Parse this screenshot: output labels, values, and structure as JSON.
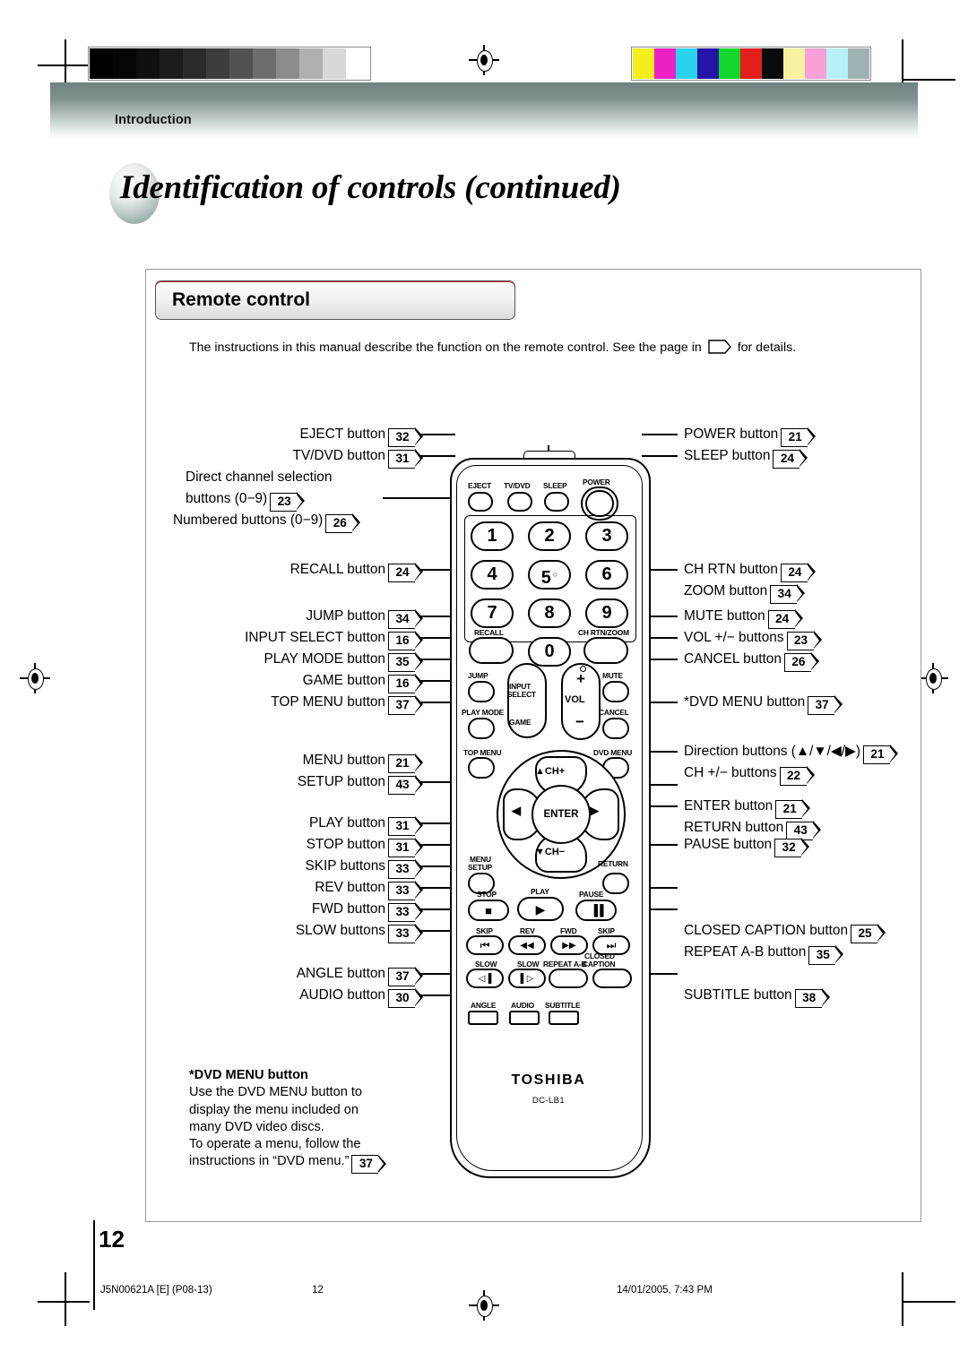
{
  "header": {
    "section": "Introduction",
    "title": "Identification of controls (continued)"
  },
  "panel": {
    "tab_label": "Remote control",
    "lead_before": "The instructions in this manual describe the function on the remote control. See the page in",
    "lead_after": "for details."
  },
  "left_labels": [
    {
      "text": "EJECT button",
      "page": "32"
    },
    {
      "text": "TV/DVD button",
      "page": "31"
    },
    {
      "text": "Direct channel selection",
      "page": ""
    },
    {
      "text": "buttons (0−9)",
      "page": "23"
    },
    {
      "text": "Numbered buttons (0−9)",
      "page": "26"
    },
    {
      "text": "RECALL button",
      "page": "24"
    },
    {
      "text": "JUMP button",
      "page": "34"
    },
    {
      "text": "INPUT SELECT button",
      "page": "16"
    },
    {
      "text": "PLAY MODE button",
      "page": "35"
    },
    {
      "text": "GAME button",
      "page": "16"
    },
    {
      "text": "TOP MENU button",
      "page": "37"
    },
    {
      "text": "MENU button",
      "page": "21"
    },
    {
      "text": "SETUP button",
      "page": "43"
    },
    {
      "text": "PLAY button",
      "page": "31"
    },
    {
      "text": "STOP button",
      "page": "31"
    },
    {
      "text": "SKIP buttons",
      "page": "33"
    },
    {
      "text": "REV button",
      "page": "33"
    },
    {
      "text": "FWD button",
      "page": "33"
    },
    {
      "text": "SLOW buttons",
      "page": "33"
    },
    {
      "text": "ANGLE button",
      "page": "37"
    },
    {
      "text": "AUDIO button",
      "page": "30"
    }
  ],
  "right_labels": [
    {
      "text": "POWER button",
      "page": "21"
    },
    {
      "text": "SLEEP button",
      "page": "24"
    },
    {
      "text": "CH RTN button",
      "page": "24"
    },
    {
      "text": "ZOOM button",
      "page": "34"
    },
    {
      "text": "MUTE button",
      "page": "24"
    },
    {
      "text": "VOL +/− buttons",
      "page": "23"
    },
    {
      "text": "CANCEL button",
      "page": "26"
    },
    {
      "text": "*DVD MENU button",
      "page": "37"
    },
    {
      "text": "Direction buttons (▲/▼/◀/▶)",
      "page": "21"
    },
    {
      "text": "CH +/− buttons",
      "page": "22"
    },
    {
      "text": "ENTER button",
      "page": "21"
    },
    {
      "text": "RETURN button",
      "page": "43"
    },
    {
      "text": "PAUSE button",
      "page": "32"
    },
    {
      "text": "CLOSED CAPTION button",
      "page": "25"
    },
    {
      "text": "REPEAT A-B button",
      "page": "35"
    },
    {
      "text": "SUBTITLE button",
      "page": "38"
    }
  ],
  "remote": {
    "caps": {
      "eject": "EJECT",
      "tvdvd": "TV/DVD",
      "sleep": "SLEEP",
      "power": "POWER",
      "recall": "RECALL",
      "chrtnzoom": "CH RTN/ZOOM",
      "jump": "JUMP",
      "mute": "MUTE",
      "input": "INPUT",
      "select": "SELECT",
      "game": "GAME",
      "playmode": "PLAY MODE",
      "cancel": "CANCEL",
      "topmenu": "TOP MENU",
      "dvdmenu": "DVD MENU",
      "menu": "MENU",
      "setup": "SETUP",
      "return": "RETURN",
      "stop": "STOP",
      "play": "PLAY",
      "pause": "PAUSE",
      "skip_l": "SKIP",
      "rev": "REV",
      "fwd": "FWD",
      "skip_r": "SKIP",
      "slow_l": "SLOW",
      "slow_r": "SLOW",
      "repeat": "REPEAT A-B",
      "closed": "CLOSED",
      "caption": "CAPTION",
      "angle": "ANGLE",
      "audio": "AUDIO",
      "subtitle": "SUBTITLE",
      "vol": "VOL",
      "chplus": "▲CH+",
      "chminus": "▼CH−",
      "enter": "ENTER"
    },
    "keypad": [
      "1",
      "2",
      "3",
      "4",
      "5",
      "6",
      "7",
      "8",
      "9",
      "0"
    ],
    "key5_mark": "○",
    "glyphs": {
      "stop": "■",
      "play": "▶",
      "pause": "▐▐",
      "skip_l": "⏮",
      "rev": "◀◀",
      "fwd": "▶▶",
      "skip_r": "⏭",
      "slow_l": "◁▐",
      "slow_r": "▌▷",
      "left": "◀",
      "right": "▶"
    },
    "brand": "TOSHIBA",
    "model": "DC-LB1"
  },
  "footnote": {
    "heading": "*DVD MENU button",
    "lines": [
      "Use the DVD MENU button to",
      "display the menu included on",
      "many DVD video discs.",
      "To operate a menu, follow the",
      "instructions in “DVD menu.”"
    ],
    "page": "37"
  },
  "footer": {
    "page_number": "12",
    "doc_code": "J5N00621A [E] (P08-13)",
    "center_page": "12",
    "timestamp": "14/01/2005, 7:43 PM"
  },
  "colors": {
    "band_top": "#6f8381",
    "grayscale": [
      "#000000",
      "#050505",
      "#101010",
      "#1c1c1c",
      "#2b2b2b",
      "#3d3d3d",
      "#525252",
      "#6d6d6d",
      "#8c8c8c",
      "#b0b0b0",
      "#d8d8d8",
      "#ffffff"
    ],
    "colorbars": [
      "#f4ee1c",
      "#ec21c4",
      "#2ad2f0",
      "#2414a8",
      "#12d62b",
      "#e51d1d",
      "#0a0a0a",
      "#f7f2a0",
      "#f79fd6",
      "#b6eff7",
      "#9fb2b2"
    ]
  }
}
